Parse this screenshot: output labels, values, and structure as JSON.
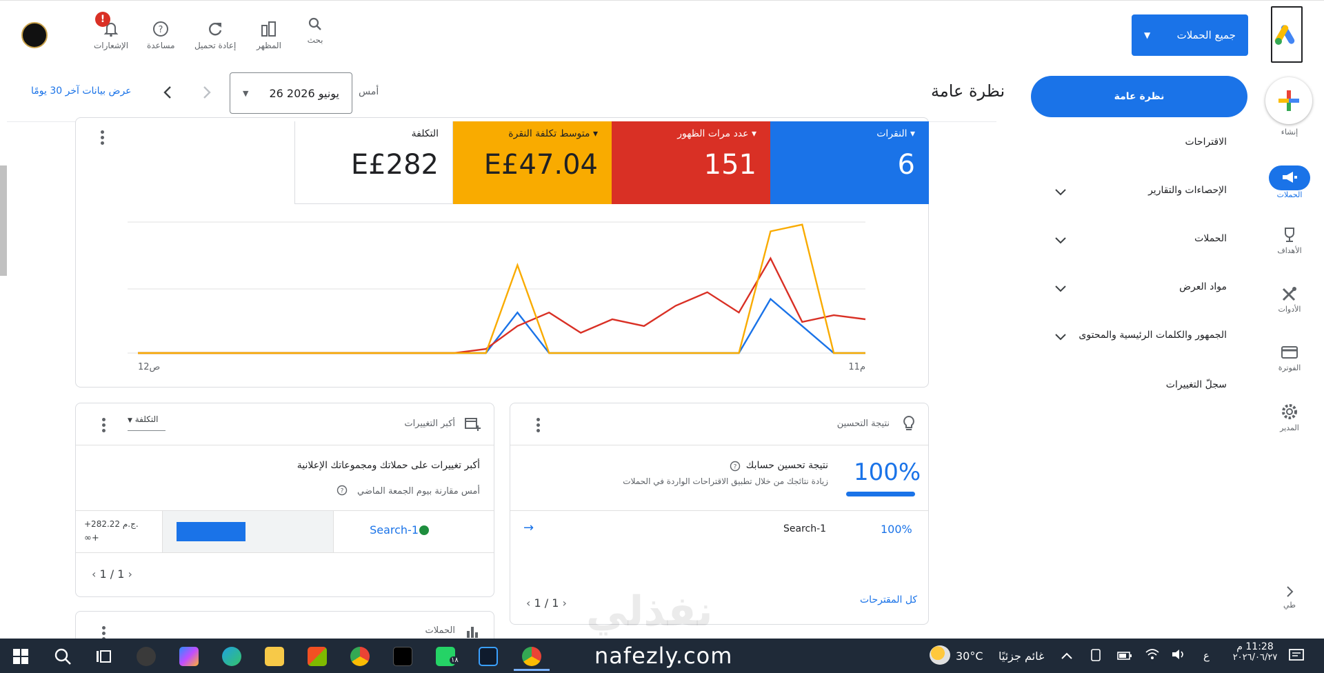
{
  "topbar": {
    "campaign_select": "جميع الحملات",
    "tools": {
      "search": "بحث",
      "appearance": "المظهر",
      "reload": "إعادة تحميل",
      "help": "مساعدة",
      "notifications": "الإشعارات"
    },
    "notification_badge": "!"
  },
  "rail": {
    "create": "إنشاء",
    "campaigns": "الحملات",
    "goals": "الأهداف",
    "tools": "الأدوات",
    "billing": "الفوترة",
    "admin": "المدير",
    "collapse": "طي"
  },
  "nav": {
    "overview": "نظرة عامة",
    "items": [
      {
        "label": "الاقتراحات",
        "has_chevron": false
      },
      {
        "label": "الإحصاءات والتقارير",
        "has_chevron": true
      },
      {
        "label": "الحملات",
        "has_chevron": true
      },
      {
        "label": "مواد العرض",
        "has_chevron": true
      },
      {
        "label": "الجمهور والكلمات الرئيسية والمحتوى",
        "has_chevron": true
      },
      {
        "label": "سجلّ التغييرات",
        "has_chevron": false
      }
    ]
  },
  "header": {
    "title": "نظرة عامة",
    "yesterday_label": "أمس",
    "date_value": "26 يونيو 2026",
    "show_30_days": "عرض بيانات آخر 30 يومًا"
  },
  "metrics": [
    {
      "label": "النقرات",
      "value": "6",
      "color": "#1a73e8",
      "dropdown": true
    },
    {
      "label": "عدد مرات الظهور",
      "value": "151",
      "color": "#d93025",
      "dropdown": true
    },
    {
      "label": "متوسط تكلفة النقرة",
      "value": "E£47.04",
      "color": "#f9ab00",
      "dropdown": true
    },
    {
      "label": "التكلفة",
      "value": "E£282",
      "color": "#ffffff",
      "dropdown": false
    }
  ],
  "chart_data": {
    "type": "line",
    "x_start_label": "12ص",
    "x_end_label": "11م",
    "series": [
      {
        "color": "#1a73e8",
        "values": [
          0,
          0,
          0,
          0,
          0,
          0,
          0,
          0,
          0,
          0,
          0,
          0,
          3,
          0,
          0,
          0,
          0,
          0,
          0,
          0,
          4,
          2,
          0,
          0
        ]
      },
      {
        "color": "#d93025",
        "values": [
          0,
          0,
          0,
          0,
          0,
          0,
          0,
          0,
          0,
          0,
          0,
          0.3,
          2,
          3,
          1.5,
          2.5,
          2,
          3.5,
          4.5,
          3,
          7,
          2.3,
          2.8,
          2.5
        ]
      },
      {
        "color": "#f9ab00",
        "values": [
          0,
          0,
          0,
          0,
          0,
          0,
          0,
          0,
          0,
          0,
          0,
          0,
          6.5,
          0,
          0,
          0,
          0,
          0,
          0,
          0,
          9,
          9.5,
          0,
          0
        ]
      }
    ]
  },
  "optimization_card": {
    "title": "نتيجة التحسين",
    "score": "100%",
    "heading": "نتيجة تحسين حسابك",
    "subtext": "زيادة نتائجك من خلال تطبيق الاقتراحات الواردة في الحملات",
    "row_campaign": "Search-1",
    "row_score": "100%",
    "pager": "1 / 1",
    "all_suggestions": "كل المقترحات",
    "score_fraction": 1.0
  },
  "changes_card": {
    "title": "أكبر التغييرات",
    "metric_select": "التكلفة",
    "heading": "أكبر تغييرات على حملاتك ومجموعاتك الإعلانية",
    "subtext": "أمس مقارنة بيوم الجمعة الماضي",
    "row_campaign": "Search-1",
    "row_value": "+282.22 ج.م.",
    "row_delta": "∞+",
    "pager": "1 / 1",
    "status_color": "#1e8e3e"
  },
  "campaigns_card": {
    "title": "الحملات"
  },
  "watermark": {
    "arabic": "نفذلي",
    "latin": "nafezly.com"
  },
  "taskbar": {
    "weather_temp": "30°C",
    "weather_text": "غائم جزئيًا",
    "time": "11:28 م",
    "date": "٢٠٢٦/٠٦/٢٧",
    "lang": "ع",
    "whatsapp_badge": "١٨"
  }
}
